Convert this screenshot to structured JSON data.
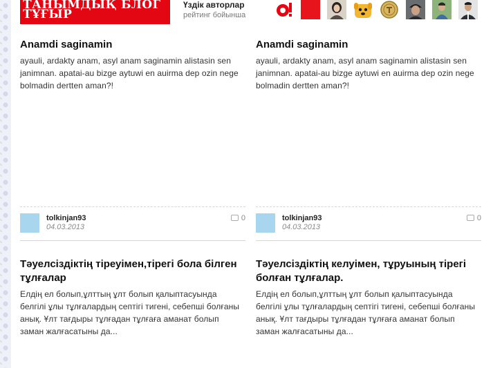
{
  "header": {
    "logo_text": "ТАНЫМДЫҚ БЛОГ ТҰҒЫР",
    "top_authors_title": "Үздік авторлар",
    "top_authors_subtitle": "рейтинг бойынша",
    "brand_color": "#e30613"
  },
  "authors": [
    {
      "name": "author-avatar-red-logo",
      "color": "#e30613"
    },
    {
      "name": "author-avatar-red-square",
      "color": "#e8141c"
    },
    {
      "name": "author-avatar-girl",
      "color": "#b9a48e"
    },
    {
      "name": "author-avatar-cartoon-dog",
      "color": "#f2b632"
    },
    {
      "name": "author-avatar-coin",
      "color": "#d8b560"
    },
    {
      "name": "author-avatar-boy-cap",
      "color": "#3b3b3b"
    },
    {
      "name": "author-avatar-boy-green",
      "color": "#6e9a5a"
    },
    {
      "name": "author-avatar-man-suit",
      "color": "#4d4d55"
    }
  ],
  "posts": [
    {
      "title": "Anamdi saginamin",
      "body": "ayauli, ardakty anam, asyl anam saginamin alistasin sen janimnan. apatai-au bizge aytuwi en auirma dep ozin nege bolmadin dertten aman?!",
      "author": "tolkinjan93",
      "date": "04.03.2013",
      "comments": "0"
    },
    {
      "title": "Anamdi saginamin",
      "body": "ayauli, ardakty anam, asyl anam saginamin alistasin sen janimnan. apatai-au bizge aytuwi en auirma dep ozin nege bolmadin dertten aman?!",
      "author": "tolkinjan93",
      "date": "04.03.2013",
      "comments": "0"
    },
    {
      "title": "Тәуелсіздіктің тіреуімен,тірегі бола білген тұлғалар",
      "body": "Елдің ел болып,ұлттың ұлт болып қалыптасуында белгілі ұлы тұлғалардың септігі тигені, себепші болғаны анық. Ұлт тағдыры тұлғадан тұлғаға аманат болып заман жалғасатыны да..."
    },
    {
      "title": "Тәуелсіздіктің келуімен, тұруының тірегі болған тұлғалар.",
      "body": "Елдің ел болып,ұлттың ұлт болып қалыптасуында белгілі ұлы тұлғалардың септігі тигені, себепші болғаны анық. Ұлт тағдыры тұлғадан тұлғаға аманат болып заман жалғасатыны да..."
    }
  ]
}
